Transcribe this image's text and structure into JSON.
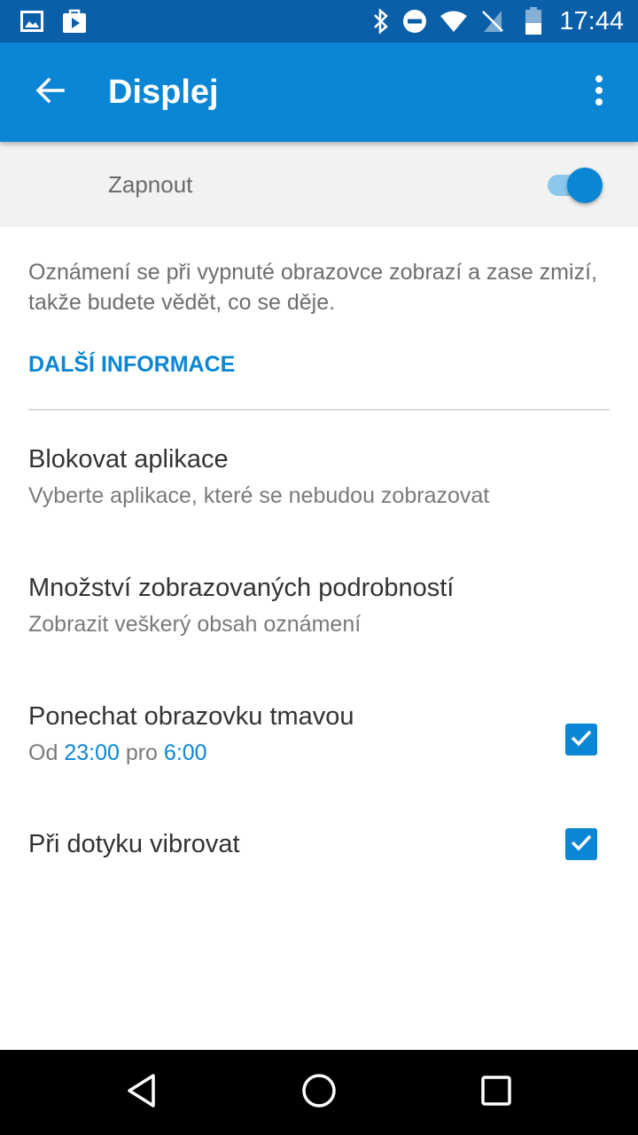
{
  "status_bar": {
    "time": "17:44",
    "icons": [
      "image-icon",
      "play-store-icon",
      "bluetooth-icon",
      "do-not-disturb-icon",
      "wifi-icon",
      "no-sim-icon",
      "battery-icon"
    ]
  },
  "app_bar": {
    "title": "Displej",
    "back_icon": "arrow-back-icon",
    "overflow_icon": "more-vert-icon"
  },
  "master_switch": {
    "label": "Zapnout",
    "checked": true
  },
  "description": "Oznámení se při vypnuté obrazovce zobrazí a zase zmizí, takže budete vědět, co se děje.",
  "more_info_label": "DALŠÍ INFORMACE",
  "preferences": [
    {
      "title": "Blokovat aplikace",
      "subtitle": "Vyberte aplikace, které se nebudou zobrazovat"
    },
    {
      "title": "Množství zobrazovaných podrobností",
      "subtitle": "Zobrazit veškerý obsah oznámení"
    },
    {
      "title": "Ponechat obrazovku tmavou",
      "subtitle_from": "Od",
      "start_time": "23:00",
      "subtitle_to": "pro",
      "end_time": "6:00",
      "checked": true
    },
    {
      "title": "Při dotyku vibrovat",
      "checked": true
    }
  ],
  "nav_bar": {
    "icons": [
      "back-triangle-icon",
      "home-circle-icon",
      "recents-square-icon"
    ]
  },
  "colors": {
    "status_bar": "#0a5fa8",
    "app_bar": "#0a86d4",
    "accent": "#0a86d4",
    "toggle_track": "#8cc7ec",
    "switch_row_bg": "#f2f2f2",
    "nav_bar": "#000000"
  }
}
